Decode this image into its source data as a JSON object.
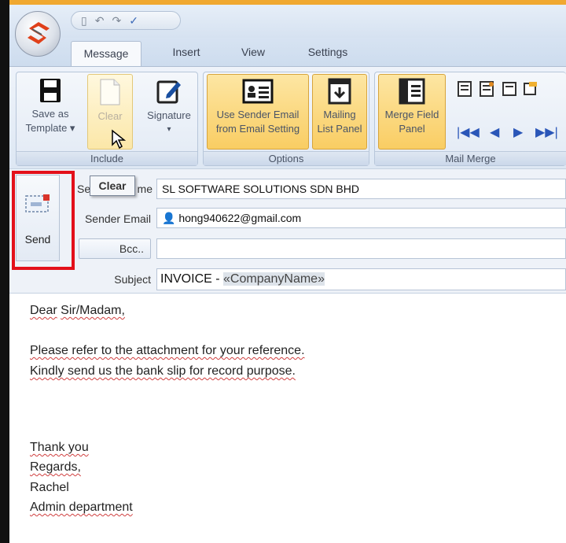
{
  "colors": {
    "accent": "#f0a830",
    "highlight_border": "#e3101a",
    "ribbon_active": "#f9cd63"
  },
  "quick_access": {
    "icons": [
      "new-document-icon",
      "undo-icon",
      "redo-icon",
      "spellcheck-icon"
    ]
  },
  "tabs": [
    {
      "label": "Message",
      "active": true
    },
    {
      "label": "Insert",
      "active": false
    },
    {
      "label": "View",
      "active": false
    },
    {
      "label": "Settings",
      "active": false
    }
  ],
  "ribbon": {
    "include": {
      "label": "Include",
      "save_as_template": {
        "line1": "Save as",
        "line2": "Template",
        "icon": "floppy-disk-icon"
      },
      "clear": {
        "line1": "Clear",
        "icon": "blank-page-icon"
      },
      "signature": {
        "line1": "Signature",
        "icon": "pen-edit-icon"
      }
    },
    "options": {
      "label": "Options",
      "use_sender_email": {
        "line1": "Use Sender Email",
        "line2": "from Email Setting",
        "icon": "contact-card-icon"
      },
      "mailing_list_panel": {
        "line1": "Mailing",
        "line2": "List Panel",
        "icon": "download-list-icon"
      }
    },
    "mail_merge": {
      "label": "Mail Merge",
      "merge_field_panel": {
        "line1": "Merge Field",
        "line2": "Panel",
        "icon": "panel-icon"
      }
    }
  },
  "tooltip": {
    "text": "Clear"
  },
  "send": {
    "label": "Send",
    "icon": "envelope-icon"
  },
  "fields": {
    "sender_name": {
      "label_prefix": "Se",
      "label_suffix": "me",
      "value": "SL SOFTWARE SOLUTIONS SDN BHD"
    },
    "sender_email": {
      "label": "Sender Email",
      "value": "hong940622@gmail.com"
    },
    "bcc": {
      "label": "Bcc..",
      "value": ""
    },
    "subject": {
      "label": "Subject",
      "value_prefix": "INVOICE - ",
      "merge_field": "«CompanyName»"
    }
  },
  "body": {
    "greeting": {
      "dear": "Dear",
      "sir": "Sir/Madam,",
      "full": "Dear Sir/Madam,"
    },
    "line1": "Please refer to the attachment for your reference.",
    "line2": "Kindly send us the bank slip for record purpose.",
    "closing": [
      "Thank you",
      "Regards,",
      "Rachel",
      "Admin department"
    ]
  }
}
